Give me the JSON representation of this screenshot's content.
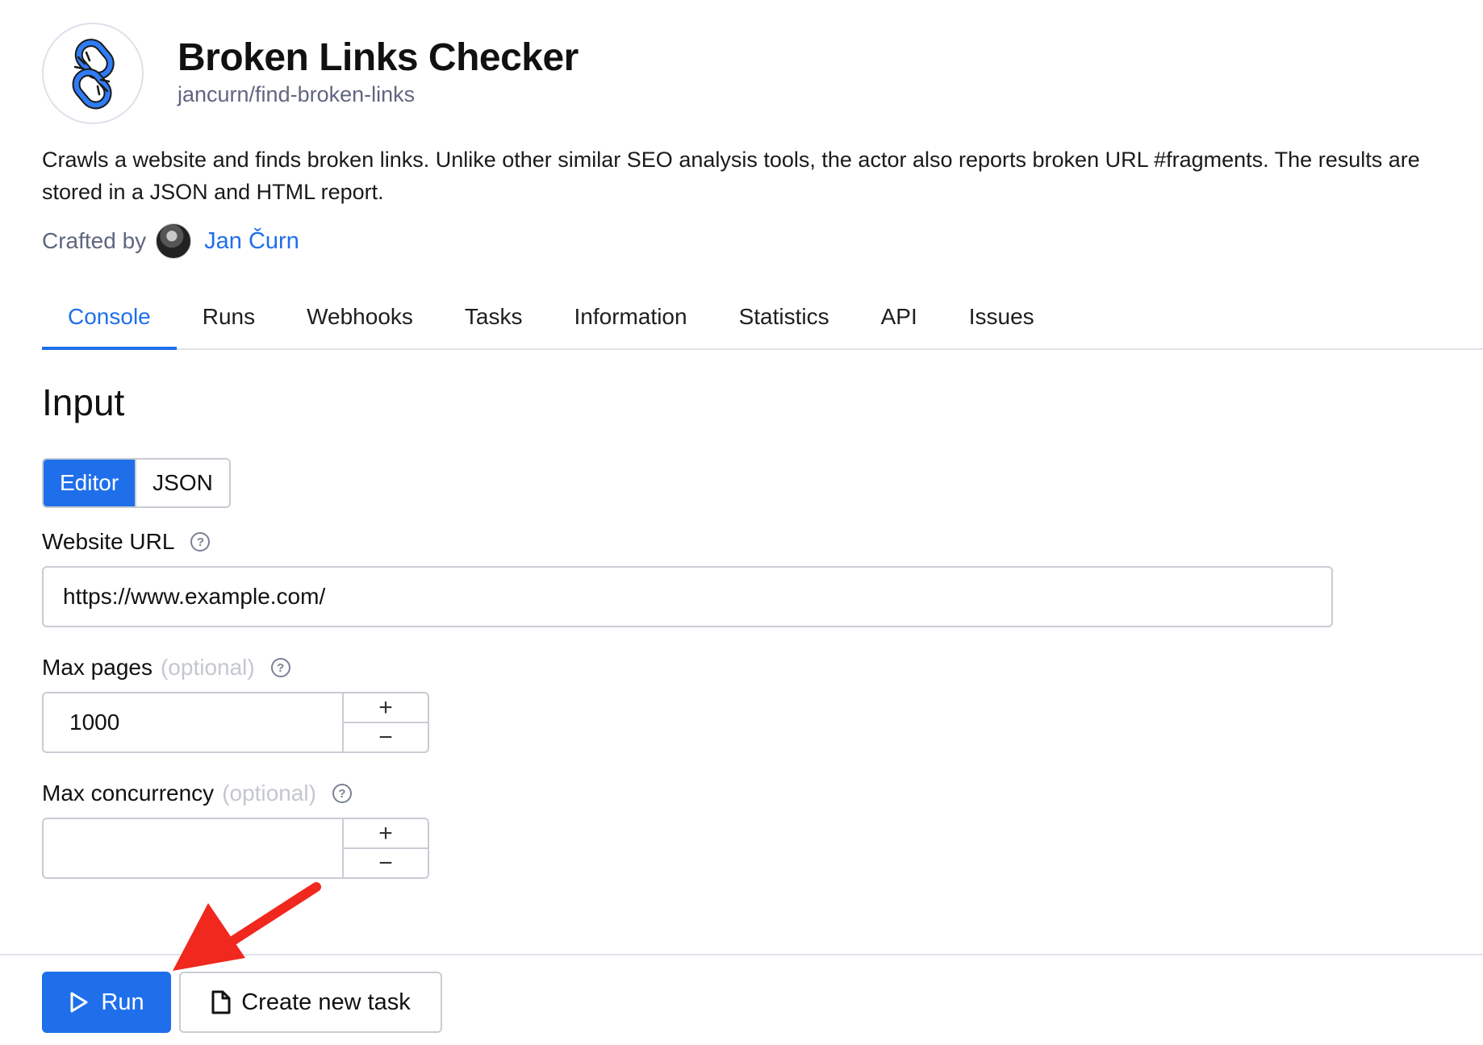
{
  "header": {
    "title": "Broken Links Checker",
    "subtitle": "jancurn/find-broken-links",
    "description": "Crawls a website and finds broken links. Unlike other similar SEO analysis tools, the actor also reports broken URL #fragments. The results are stored in a JSON and HTML report.",
    "crafted_by_label": "Crafted by",
    "author_name": "Jan Čurn",
    "logo_icon": "broken-chain-link-icon"
  },
  "tabs": [
    {
      "label": "Console",
      "active": true
    },
    {
      "label": "Runs",
      "active": false
    },
    {
      "label": "Webhooks",
      "active": false
    },
    {
      "label": "Tasks",
      "active": false
    },
    {
      "label": "Information",
      "active": false
    },
    {
      "label": "Statistics",
      "active": false
    },
    {
      "label": "API",
      "active": false
    },
    {
      "label": "Issues",
      "active": false
    }
  ],
  "input": {
    "section_title": "Input",
    "mode_toggle": {
      "editor_label": "Editor",
      "json_label": "JSON",
      "selected": "Editor"
    },
    "website_url": {
      "label": "Website URL",
      "value": "https://www.example.com/"
    },
    "max_pages": {
      "label": "Max pages",
      "optional_label": "(optional)",
      "value": "1000"
    },
    "max_concurrency": {
      "label": "Max concurrency",
      "optional_label": "(optional)",
      "value": ""
    },
    "stepper_plus": "+",
    "stepper_minus": "−"
  },
  "footer": {
    "run_label": "Run",
    "create_task_label": "Create new task"
  },
  "colors": {
    "accent": "#1f6feb",
    "annotation_arrow": "#f0281e",
    "muted_text": "#5f6680",
    "border": "#c9ccd3"
  }
}
